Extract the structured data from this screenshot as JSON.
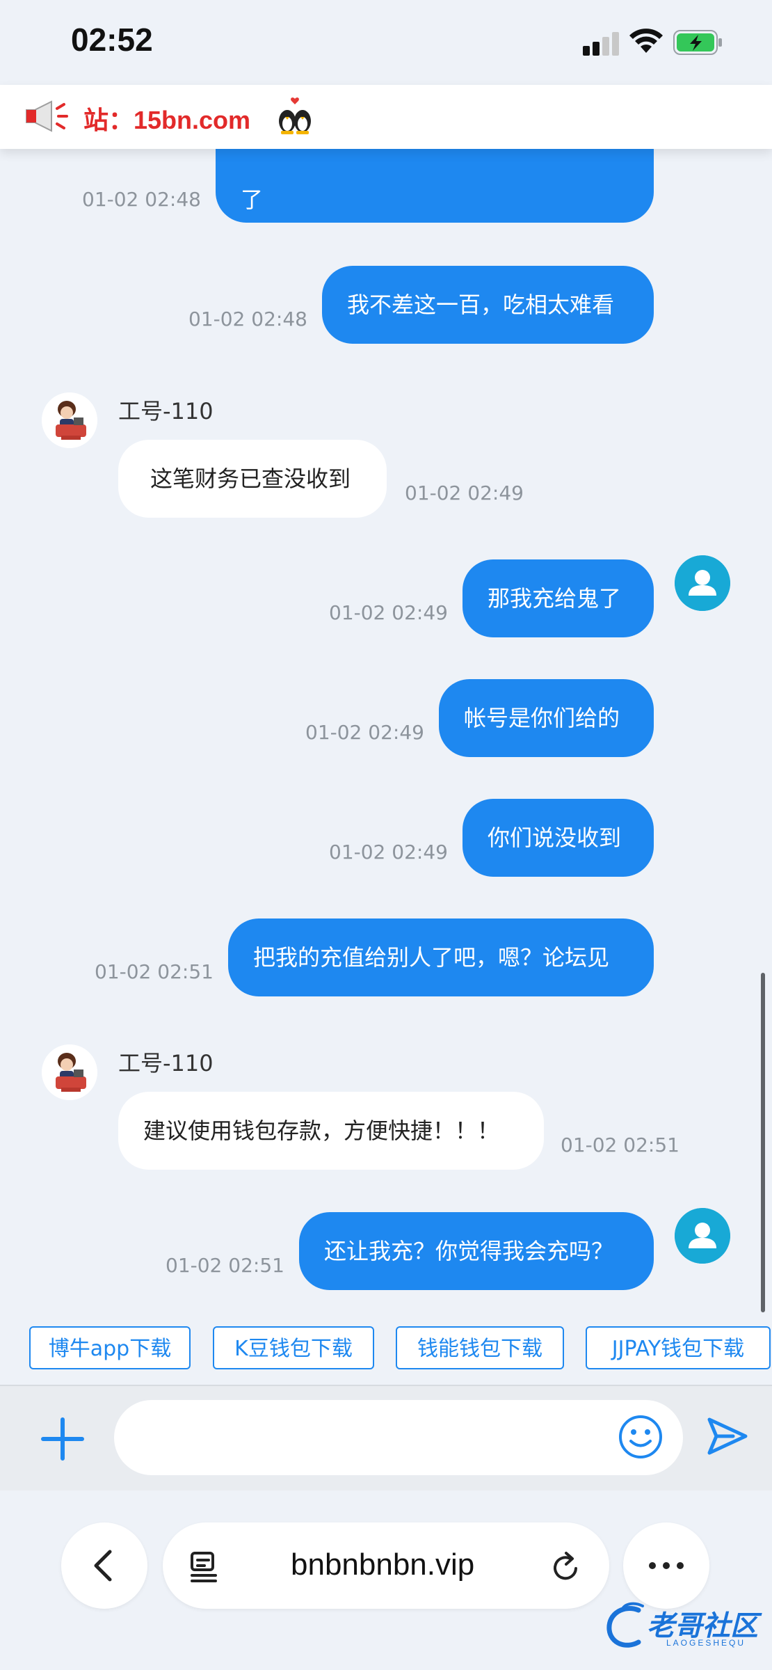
{
  "status_bar": {
    "time": "02:52"
  },
  "notice": {
    "text": "站：15bn.com"
  },
  "messages": [
    {
      "from": "user",
      "text": "了",
      "time": "01-02 02:48"
    },
    {
      "from": "user",
      "text": "我不差这一百，吃相太难看",
      "time": "01-02 02:48"
    },
    {
      "from": "agent",
      "sender": "工号-110",
      "text": "这笔财务已查没收到",
      "time": "01-02 02:49"
    },
    {
      "from": "user",
      "text": "那我充给鬼了",
      "time": "01-02 02:49"
    },
    {
      "from": "user",
      "text": "帐号是你们给的",
      "time": "01-02 02:49"
    },
    {
      "from": "user",
      "text": "你们说没收到",
      "time": "01-02 02:49"
    },
    {
      "from": "user",
      "text": "把我的充值给别人了吧，嗯？论坛见",
      "time": "01-02 02:51"
    },
    {
      "from": "agent",
      "sender": "工号-110",
      "text": "建议使用钱包存款，方便快捷！！！",
      "time": "01-02 02:51"
    },
    {
      "from": "user",
      "text": "还让我充？你觉得我会充吗？",
      "time": "01-02 02:51"
    }
  ],
  "quick_links": [
    "博牛app下载",
    "K豆钱包下载",
    "钱能钱包下载",
    "JJPAY钱包下载"
  ],
  "input": {
    "value": "",
    "placeholder": ""
  },
  "browser": {
    "url": "bnbnbnbn.vip"
  },
  "watermark": {
    "text": "老哥社区",
    "sub": "LAOGESHEQU"
  },
  "colors": {
    "accent": "#1e88f0",
    "notice_text": "#e22a2a",
    "background": "#eef2f8"
  }
}
